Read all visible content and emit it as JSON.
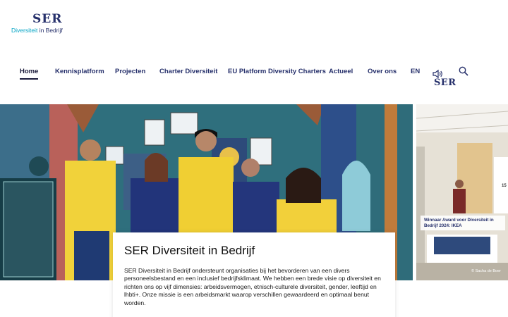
{
  "logo": {
    "mark": "SER",
    "sub_part1": "Diversiteit",
    "sub_part2": "in Bedrijf"
  },
  "nav": {
    "items": [
      {
        "label": "Home",
        "active": true
      },
      {
        "label": "Kennisplatform"
      },
      {
        "label": "Projecten"
      },
      {
        "label": "Charter Diversiteit"
      },
      {
        "label": "EU Platform Diversity Charters"
      },
      {
        "label": "Actueel"
      },
      {
        "label": "Over ons"
      },
      {
        "label": "EN"
      }
    ],
    "ser_logo": "SER",
    "icons": [
      "speaker-icon",
      "search-icon"
    ]
  },
  "hero": {
    "caption": "Winnaar Award voor Diversiteit in Bedrijf 2024: IKEA",
    "credit": "© Sacha de Boer",
    "side_number": "15"
  },
  "card": {
    "title": "SER Diversiteit in Bedrijf",
    "body": "SER Diversiteit in Bedrijf ondersteunt organisaties bij het bevorderen van een divers personeelsbestand en een inclusief bedrijfsklimaat. We hebben een brede visie op diversiteit en richten ons op vijf dimensies: arbeidsvermogen, etnisch-culturele diversiteit, gender, leeftijd en lhbti+. Onze missie is een arbeidsmarkt waarop verschillen gewaardeerd en optimaal benut worden."
  },
  "colors": {
    "brand": "#26306b",
    "accent": "#00a3c4"
  }
}
